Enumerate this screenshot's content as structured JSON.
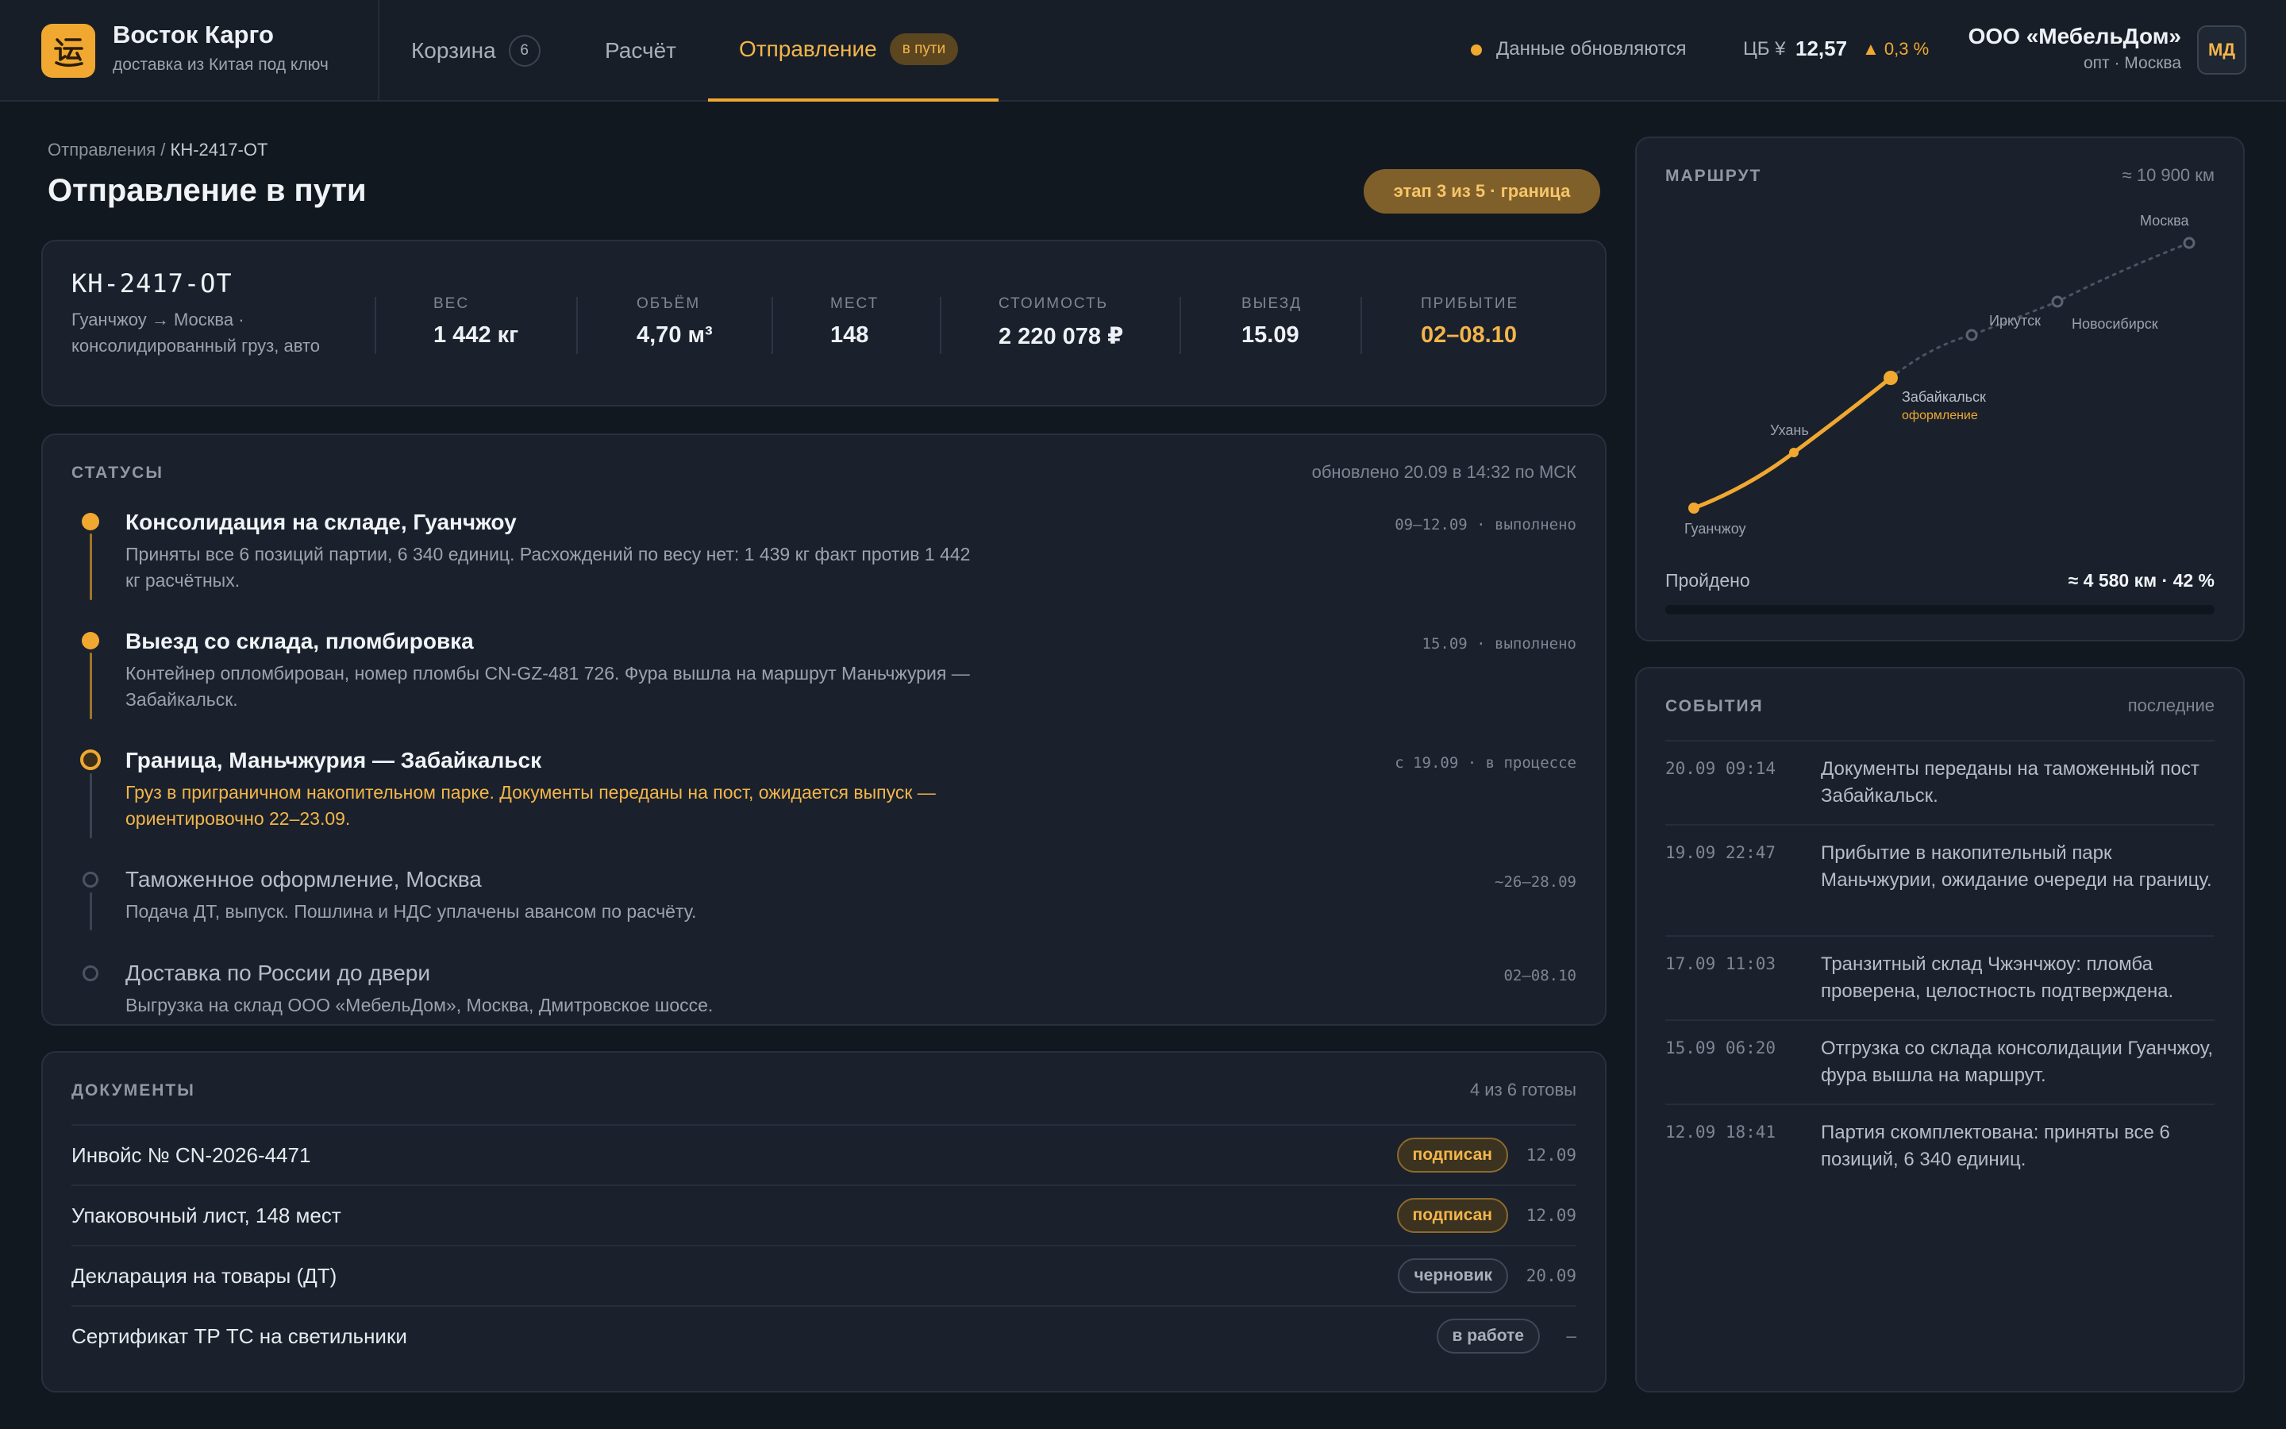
{
  "brand": {
    "name": "Восток Карго",
    "subtitle": "доставка из Китая под ключ"
  },
  "nav": {
    "cart_label": "Корзина",
    "cart_count": "6",
    "calc_label": "Расчёт",
    "ship_label": "Отправление",
    "ship_badge": "в пути"
  },
  "status_bar": {
    "live_text": "Данные обновляются",
    "cb_label": "ЦБ ¥",
    "cb_value": "12,57",
    "cb_change": "▲ 0,3 %"
  },
  "account": {
    "org": "ООО «МебельДом»",
    "sub": "опт · Москва",
    "initials": "МД"
  },
  "breadcrumb": {
    "parent": "Отправления",
    "sep": " / ",
    "current": "КН-2417-ОТ"
  },
  "page": {
    "title": "Отправление в пути",
    "stage": "этап 3 из 5 · граница"
  },
  "summary": {
    "id": "КН-2417-ОТ",
    "route": "Гуанчжоу → Москва · консолидированный груз, авто",
    "metrics": [
      {
        "label": "ВЕС",
        "value": "1 442 кг"
      },
      {
        "label": "ОБЪЁМ",
        "value": "4,70 м³"
      },
      {
        "label": "МЕСТ",
        "value": "148"
      },
      {
        "label": "СТОИМОСТЬ",
        "value": "2 220 078 ₽"
      },
      {
        "label": "ВЫЕЗД",
        "value": "15.09"
      },
      {
        "label": "ПРИБЫТИЕ",
        "value": "02–08.10"
      }
    ]
  },
  "statuses": {
    "title": "СТАТУСЫ",
    "updated": "обновлено 20.09 в 14:32 по МСК",
    "items": [
      {
        "title": "Консолидация на складе, Гуанчжоу",
        "desc": "Приняты все 6 позиций партии, 6 340 единиц. Расхождений по весу нет: 1 439 кг факт против 1 442 кг расчётных.",
        "meta": "09–12.09 · выполнено",
        "state": "done"
      },
      {
        "title": "Выезд со склада, пломбировка",
        "desc": "Контейнер опломбирован, номер пломбы CN-GZ-481 726. Фура вышла на маршрут Маньчжурия — Забайкальск.",
        "meta": "15.09 · выполнено",
        "state": "done"
      },
      {
        "title": "Граница, Маньчжурия — Забайкальск",
        "desc": "Груз в приграничном накопительном парке. Документы переданы на пост, ожидается выпуск — ориентировочно 22–23.09.",
        "meta": "с 19.09 · в процессе",
        "state": "active"
      },
      {
        "title": "Таможенное оформление, Москва",
        "desc": "Подача ДТ, выпуск. Пошлина и НДС уплачены авансом по расчёту.",
        "meta": "~26–28.09",
        "state": "pending"
      },
      {
        "title": "Доставка по России до двери",
        "desc": "Выгрузка на склад ООО «МебельДом», Москва, Дмитровское шоссе.",
        "meta": "02–08.10",
        "state": "pending"
      }
    ]
  },
  "documents": {
    "title": "ДОКУМЕНТЫ",
    "ready": "4 из 6 готовы",
    "items": [
      {
        "name": "Инвойс № CN-2026-4471",
        "badge": "подписан",
        "date": "12.09",
        "kind": "signed"
      },
      {
        "name": "Упаковочный лист, 148 мест",
        "badge": "подписан",
        "date": "12.09",
        "kind": "signed"
      },
      {
        "name": "Декларация на товары (ДТ)",
        "badge": "черновик",
        "date": "20.09",
        "kind": "draft"
      },
      {
        "name": "Сертификат ТР ТС на светильники",
        "badge": "в работе",
        "date": "–",
        "kind": "draft"
      }
    ]
  },
  "route": {
    "title": "МАРШРУТ",
    "distance": "≈ 10 900 км",
    "passed_label": "Пройдено",
    "passed_value": "≈ 4 580 км · 42 %",
    "progress": 0.42,
    "cities": [
      {
        "name": "Гуанчжоу",
        "status": "passed"
      },
      {
        "name": "Ухань",
        "status": "passed"
      },
      {
        "name": "Забайкальск",
        "note": "оформление",
        "status": "current"
      },
      {
        "name": "Иркутск",
        "status": "upcoming"
      },
      {
        "name": "Новосибирск",
        "status": "upcoming"
      },
      {
        "name": "Москва",
        "status": "upcoming"
      }
    ]
  },
  "events": {
    "title": "СОБЫТИЯ",
    "meta": "последние",
    "items": [
      {
        "time": "20.09 09:14",
        "text": "Документы переданы на таможенный пост Забайкальск."
      },
      {
        "time": "19.09 22:47",
        "text": "Прибытие в накопительный парк Маньчжурии, ожидание очереди на границу."
      },
      {
        "time": "17.09 11:03",
        "text": "Транзитный склад Чжэнчжоу: пломба проверена, целостность подтверждена."
      },
      {
        "time": "15.09 06:20",
        "text": "Отгрузка со склада консолидации Гуанчжоу, фура вышла на маршрут."
      },
      {
        "time": "12.09 18:41",
        "text": "Партия скомплектована: приняты все 6 позиций, 6 340 единиц."
      }
    ]
  },
  "colors": {
    "accent": "#f0a830",
    "bg": "#121820",
    "card": "#1a212c",
    "text": "#eef1f5",
    "muted": "#9aa3ae"
  }
}
